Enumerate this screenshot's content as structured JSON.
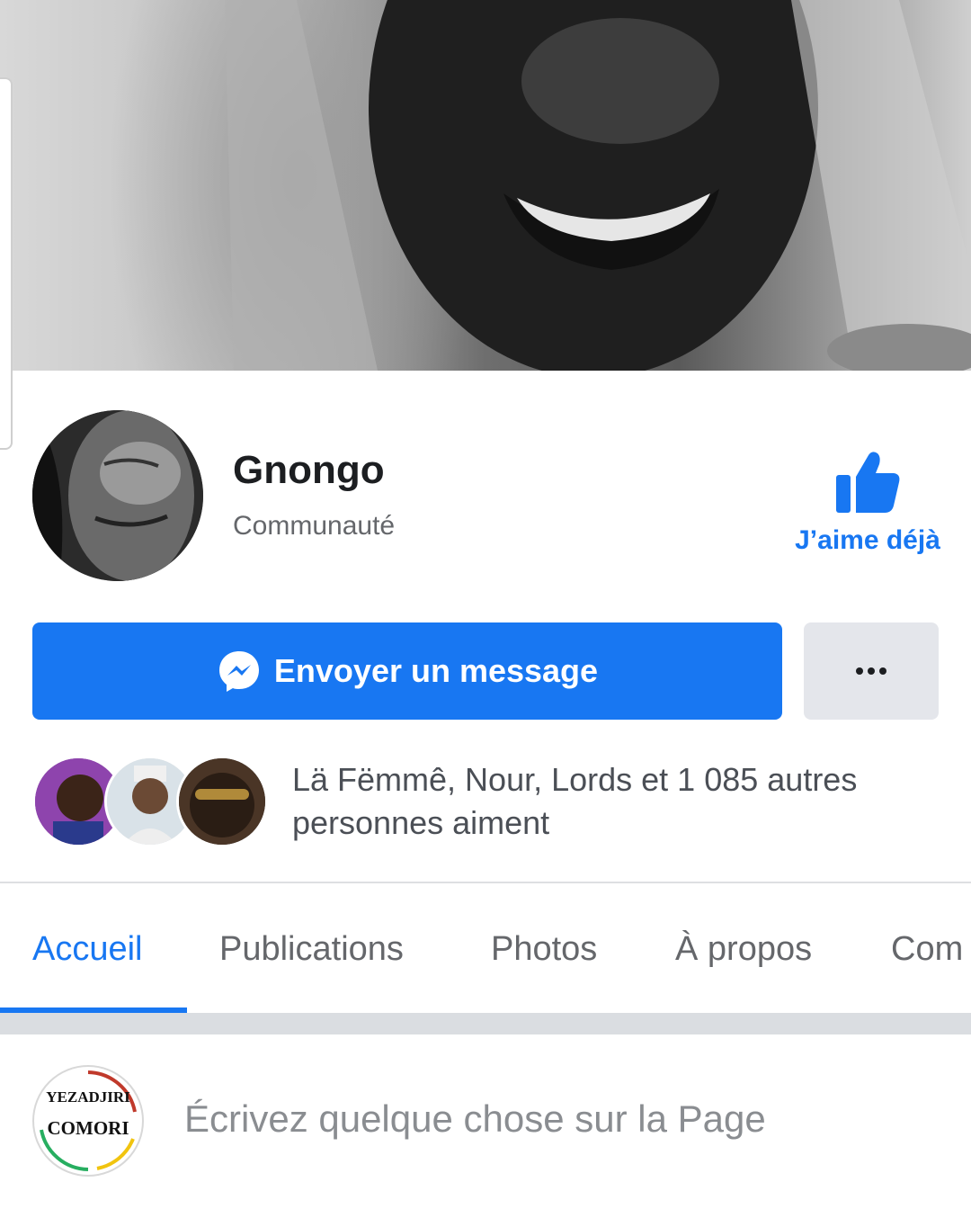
{
  "colors": {
    "accent": "#1877f2",
    "text_primary": "#1c1e21",
    "text_secondary": "#65676b",
    "button_gray": "#e4e6eb"
  },
  "page": {
    "name": "Gnongo",
    "category": "Communauté"
  },
  "like": {
    "icon": "thumbs-up-icon",
    "label": "J’aime déjà"
  },
  "actions": {
    "message_label": "Envoyer un message",
    "message_icon": "messenger-icon",
    "more_icon": "more-dots-icon"
  },
  "social": {
    "likes_text": "Lä Fëmmê, Nour, Lords et 1 085 autres personnes aiment"
  },
  "tabs": [
    {
      "label": "Accueil",
      "active": true
    },
    {
      "label": "Publications",
      "active": false
    },
    {
      "label": "Photos",
      "active": false
    },
    {
      "label": "À propos",
      "active": false
    },
    {
      "label": "Com",
      "active": false
    }
  ],
  "composer": {
    "placeholder": "Écrivez quelque chose sur la Page",
    "logo_line1": "YEZADJIRI",
    "logo_line2": "COMORI"
  }
}
